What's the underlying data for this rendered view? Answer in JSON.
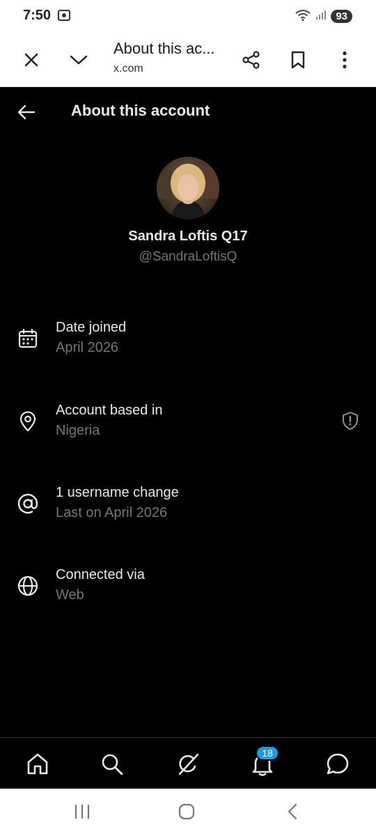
{
  "status_bar": {
    "time": "7:50",
    "battery": "93",
    "icons": [
      "screenshot-icon",
      "wifi-icon",
      "signal-icon",
      "battery-icon"
    ]
  },
  "browser": {
    "page_title": "About this ac...",
    "url": "x.com",
    "icons": [
      "close-icon",
      "chevron-down-icon",
      "share-icon",
      "bookmark-icon",
      "more-vertical-icon"
    ]
  },
  "header": {
    "title": "About this account",
    "back_icon": "back-arrow-icon"
  },
  "profile": {
    "display_name": "Sandra Loftis Q17",
    "handle": "@SandraLoftisQ"
  },
  "info_items": [
    {
      "label": "Date joined",
      "value": "April 2026",
      "icon": "calendar-icon"
    },
    {
      "label": "Account based in",
      "value": "Nigeria",
      "icon": "location-pin-icon",
      "side_icon": "shield-alert-icon"
    },
    {
      "label": "1 username change",
      "value": "Last on April 2026",
      "icon": "at-sign-icon"
    },
    {
      "label": "Connected via",
      "value": "Web",
      "icon": "globe-icon"
    }
  ],
  "bottom_nav": {
    "items": [
      "home-icon",
      "search-icon",
      "grok-icon",
      "notifications-icon",
      "messages-icon"
    ],
    "notifications_count": "18"
  },
  "system_nav": {
    "items": [
      "recents-icon",
      "home-circle-icon",
      "back-icon"
    ]
  },
  "colors": {
    "background": "#000000",
    "primary_text": "#e7e9ea",
    "secondary_text": "#71767b",
    "accent": "#1d9bf0",
    "divider": "#2f3336"
  }
}
